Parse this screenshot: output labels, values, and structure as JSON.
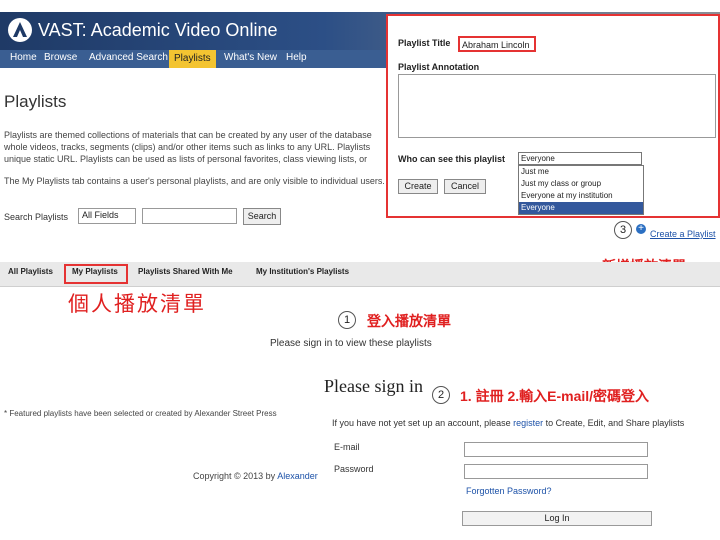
{
  "header": {
    "app_title": "VAST: Academic Video Online"
  },
  "nav": {
    "items": [
      "Home",
      "Browse",
      "Advanced Search",
      "Playlists",
      "What's New",
      "Help"
    ]
  },
  "page": {
    "title": "Playlists",
    "paragraphs": [
      "Playlists are themed collections of materials that can be created by any user of the database",
      "whole videos, tracks, segments (clips) and/or other items such as links to any URL. Playlists",
      "unique static URL. Playlists can be used as lists of personal favorites, class viewing lists, or",
      "The My Playlists tab contains a user's personal playlists, and are only visible to individual users."
    ],
    "search_label": "Search Playlists",
    "search_select": "All Fields",
    "search_button": "Search"
  },
  "panel": {
    "title_label": "Playlist Title",
    "title_value": "Abraham Lincoln",
    "annotation_label": "Playlist Annotation",
    "visibility_label": "Who can see this playlist",
    "visibility_selected": "Everyone",
    "visibility_options": [
      "Just me",
      "Just my class or group",
      "Everyone at my institution",
      "Everyone"
    ],
    "create_button": "Create",
    "cancel_button": "Cancel"
  },
  "create_link": "Create a Playlist",
  "annotations": {
    "step1_number": "1",
    "step1_text": "登入播放清單",
    "step2_number": "2",
    "step2_text": "1. 註冊 2.輸入E-mail/密碼登入",
    "step3_number": "3",
    "step3_text": "新增播放清單",
    "my_playlists_text": "個人播放清單"
  },
  "tabs": [
    "All Playlists",
    "My Playlists",
    "Playlists Shared With Me",
    "My Institution's Playlists"
  ],
  "signin_message": "Please sign in to view these playlists",
  "signin": {
    "title": "Please sign in",
    "desc_prefix": "If you have not yet set up an account, please ",
    "register_link": "register",
    "desc_suffix": " to Create, Edit, and Share playlists",
    "email_label": "E-mail",
    "password_label": "Password",
    "forgot_link": "Forgotten Password?",
    "login_button": "Log In"
  },
  "featured_note": "* Featured playlists have been selected or created by Alexander Street Press",
  "copyright": {
    "prefix": "Copyright © 2013 by ",
    "link": "Alexander Street Press"
  }
}
